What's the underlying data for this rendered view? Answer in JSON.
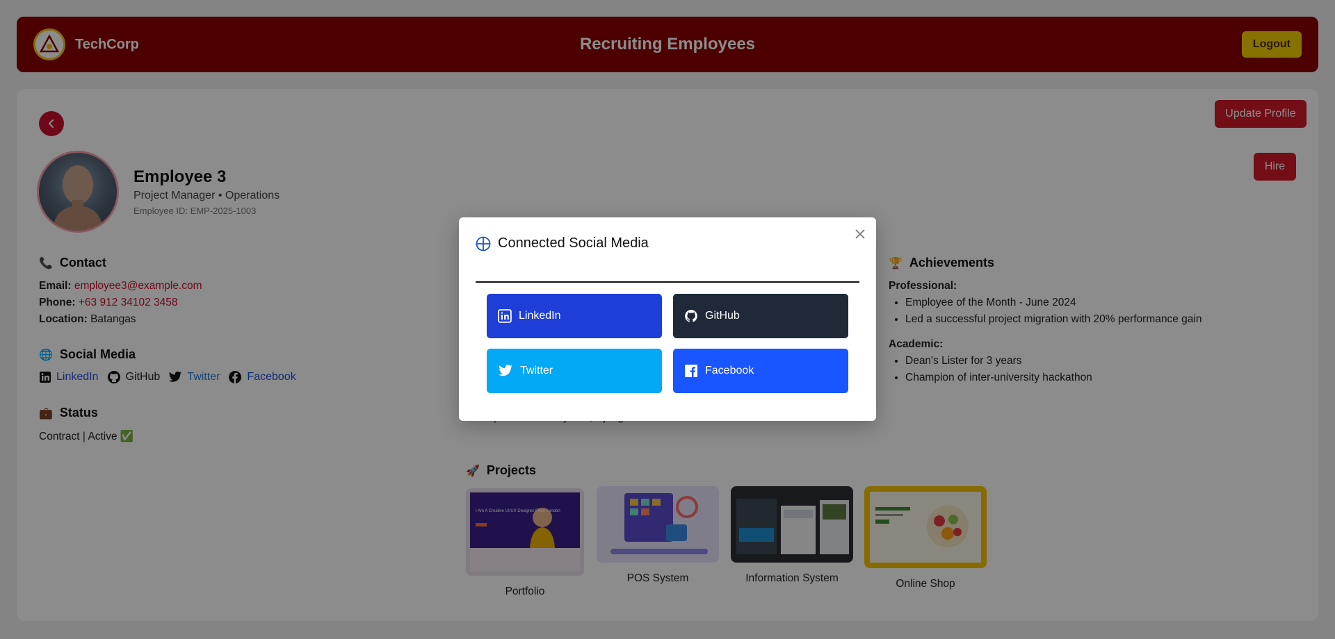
{
  "header": {
    "brand": "TechCorp",
    "title": "Recruiting Employees",
    "logout_label": "Logout"
  },
  "actions": {
    "update_profile_label": "Update Profile",
    "hire_label": "Hire"
  },
  "profile": {
    "name": "Employee 3",
    "role_line": "Project Manager • Operations",
    "employee_id_line": "Employee ID: EMP-2025-1003"
  },
  "contact": {
    "heading": "Contact",
    "email_label": "Email:",
    "email": "employee3@example.com",
    "phone_label": "Phone:",
    "phone": "+63 912 34102 3458",
    "location_label": "Location:",
    "location": "Batangas"
  },
  "social_media": {
    "heading": "Social Media",
    "links": [
      "LinkedIn",
      "GitHub",
      "Twitter",
      "Facebook"
    ]
  },
  "status": {
    "heading": "Status",
    "value": "Contract | Active",
    "check": "✅"
  },
  "achievements": {
    "heading": "Achievements",
    "professional_label": "Professional:",
    "professional": [
      "Employee of the Month - June 2024",
      "Led a successful project migration with 20% performance gain"
    ],
    "academic_label": "Academic:",
    "academic": [
      "Dean's Lister for 3 years",
      "Champion of inter-university hackathon"
    ]
  },
  "skills_partial": "Specialized in Python, Django",
  "projects": {
    "heading": "Projects",
    "items": [
      "Portfolio",
      "POS System",
      "Information System",
      "Online Shop"
    ],
    "portfolio_thumb_text": "I Am A Creative UI/UX Designer From London"
  },
  "modal": {
    "title": "Connected Social Media",
    "buttons": [
      "LinkedIn",
      "GitHub",
      "Twitter",
      "Facebook"
    ]
  },
  "colors": {
    "header_bg": "#8b0000",
    "accent_red": "#d11a2a",
    "logout_bg": "#f5d000",
    "linkedin": "#1d3fd8",
    "github": "#1f2937",
    "twitter": "#03a9f4",
    "facebook": "#1a56ff"
  },
  "icons": {
    "back": "chevron-left-icon",
    "close": "close-icon",
    "modal_title": "globe-icon",
    "contact": "phone-icon",
    "social": "globe-icon",
    "status": "briefcase-icon",
    "achievements": "trophy-icon",
    "projects": "rocket-icon"
  }
}
